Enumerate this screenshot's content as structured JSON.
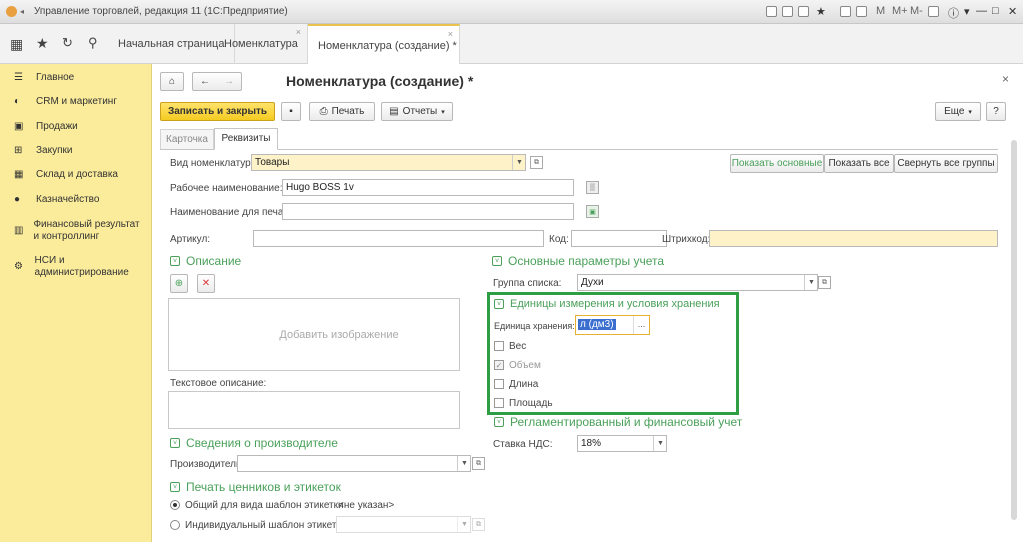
{
  "window": {
    "title": "Управление торговлей, редакция 11  (1С:Предприятие)"
  },
  "tabs": {
    "home": "Начальная страница",
    "nomenclature": "Номенклатура",
    "create": "Номенклатура (создание) *"
  },
  "sidebar": {
    "items": [
      {
        "label": "Главное",
        "icon": "menu-icon"
      },
      {
        "label": "CRM и маркетинг",
        "icon": "crm-icon"
      },
      {
        "label": "Продажи",
        "icon": "bag-icon"
      },
      {
        "label": "Закупки",
        "icon": "cart-icon"
      },
      {
        "label": "Склад и доставка",
        "icon": "warehouse-icon"
      },
      {
        "label": "Казначейство",
        "icon": "coin-icon"
      },
      {
        "label": "Финансовый результат и контроллинг",
        "icon": "chart-icon"
      },
      {
        "label": "НСИ и администрирование",
        "icon": "gear-icon"
      }
    ]
  },
  "form": {
    "title": "Номенклатура (создание) *",
    "save_close": "Записать и закрыть",
    "print": "Печать",
    "reports": "Отчеты",
    "more": "Еще",
    "help": "?",
    "tab_card": "Карточка",
    "tab_details": "Реквизиты",
    "show_main": "Показать основные",
    "show_all": "Показать все",
    "collapse_all": "Свернуть все группы"
  },
  "fields": {
    "kind_label": "Вид номенклатуры:",
    "kind_value": "Товары",
    "work_name_label": "Рабочее наименование:",
    "work_name_value": "Hugo BOSS 1v",
    "print_name_label": "Наименование для печати:",
    "print_name_value": "",
    "article_label": "Артикул:",
    "code_label": "Код:",
    "barcode_label": "Штрихкод:"
  },
  "description": {
    "group": "Описание",
    "add_image": "Добавить изображение",
    "text_desc_label": "Текстовое описание:"
  },
  "accounting": {
    "group": "Основные параметры учета",
    "list_group_label": "Группа списка:",
    "list_group_value": "Духи"
  },
  "units": {
    "group": "Единицы измерения и условия хранения",
    "storage_unit_label": "Единица хранения:",
    "storage_unit_value": "л (дм3)",
    "weight": "Вес",
    "volume": "Объем",
    "length": "Длина",
    "area": "Площадь"
  },
  "regulated": {
    "group": "Регламентированный и финансовый учет",
    "vat_label": "Ставка НДС:",
    "vat_value": "18%"
  },
  "manufacturer": {
    "group": "Сведения о производителе",
    "producer_label": "Производитель:"
  },
  "labels_print": {
    "group": "Печать ценников и этикеток",
    "common_template": "Общий для вида шаблон этикетки",
    "not_specified": "<не указан>",
    "individual_template": "Индивидуальный шаблон этикетки"
  },
  "colors": {
    "accent": "#4aa05a",
    "sidebar": "#fbec9c",
    "highlight_box": "#2e9e44"
  }
}
